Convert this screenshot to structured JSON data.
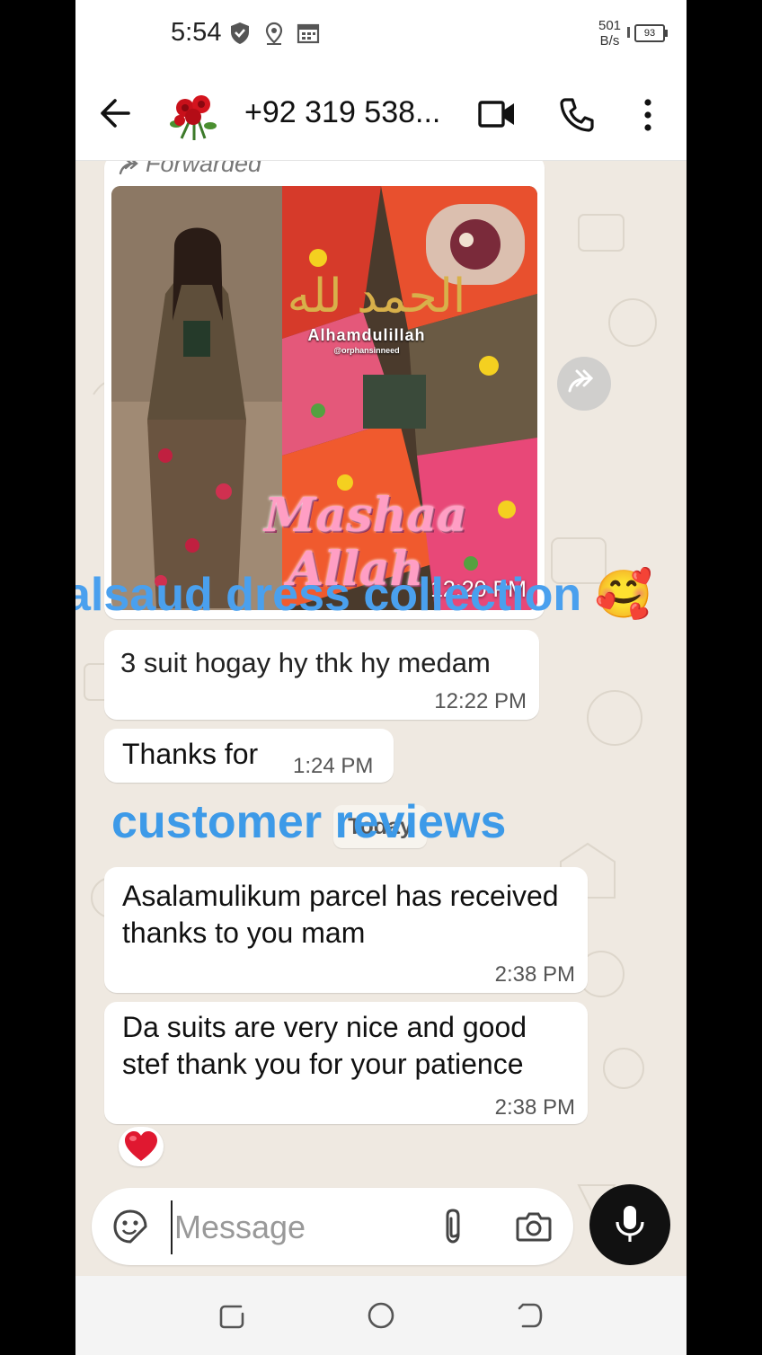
{
  "status_bar": {
    "time": "5:54",
    "net_speed_value": "501",
    "net_speed_unit": "B/s",
    "battery": "93"
  },
  "header": {
    "contact_name": "+92 319 538..."
  },
  "messages": {
    "forwarded_label": "Forwarded",
    "photo_time": "12:20 PM",
    "msg1_text": "3 suit hogay hy thk hy medam",
    "msg1_time": "12:22 PM",
    "msg2_text": "Thanks for",
    "msg2_time": "1:24 PM",
    "day_separator": "Today",
    "msg3_text": "Asalamulikum parcel has received thanks to you mam",
    "msg3_time": "2:38 PM",
    "msg4_text": "Da suits are very nice and good stef thank you for your patience",
    "msg4_time": "2:38 PM",
    "reaction": "❤️"
  },
  "photo": {
    "arabic_text": "الحمد لله",
    "alhamdulillah": "Alhamdulillah",
    "handle": "@orphansinneed",
    "mashaallah_1": "Mashaa",
    "mashaallah_2": "Allah"
  },
  "overlays": {
    "caption_1": "alsaud dress collection 🥰",
    "caption_2": "customer reviews"
  },
  "composer": {
    "placeholder": "Message"
  },
  "colors": {
    "chat_bg": "#efe9e1",
    "bubble": "#ffffff",
    "overlay_text": "#4aa0ee",
    "mic_button": "#111111"
  }
}
